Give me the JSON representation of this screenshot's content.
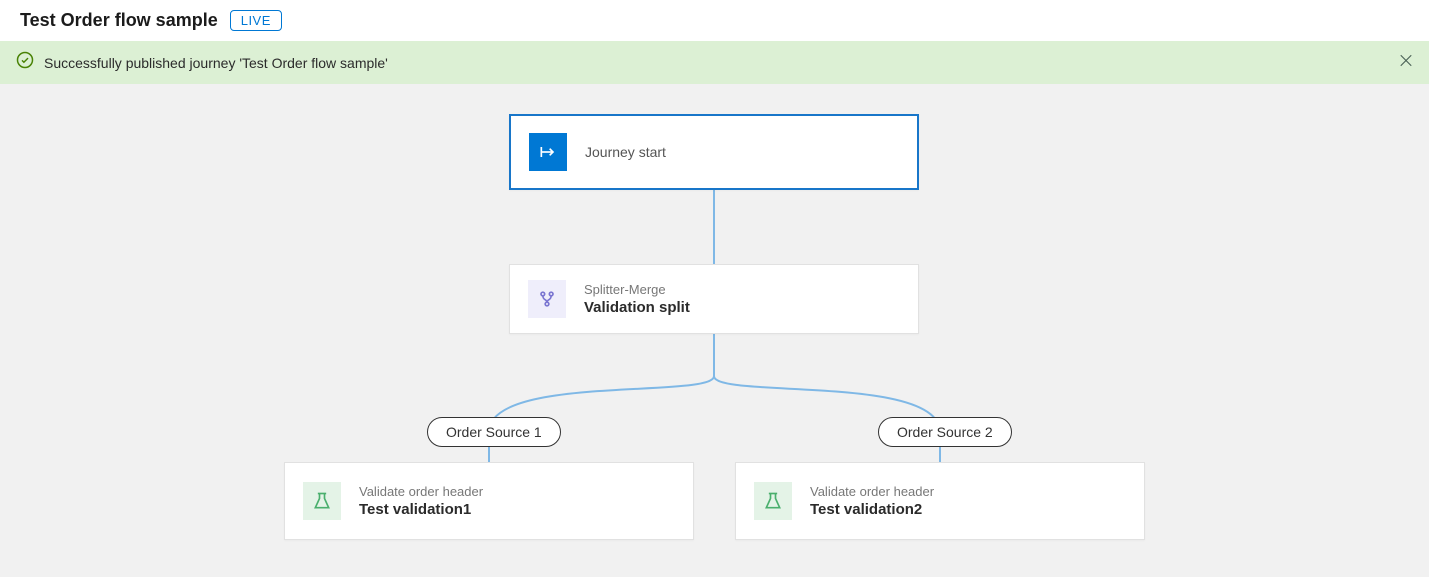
{
  "header": {
    "title": "Test Order flow sample",
    "status_badge": "LIVE"
  },
  "notification": {
    "message": "Successfully published journey 'Test Order flow sample'"
  },
  "nodes": {
    "start": {
      "label": "Journey start"
    },
    "split": {
      "type": "Splitter-Merge",
      "name": "Validation split"
    },
    "branch1": {
      "label": "Order Source 1"
    },
    "branch2": {
      "label": "Order Source 2"
    },
    "leaf1": {
      "type": "Validate order header",
      "name": "Test validation1"
    },
    "leaf2": {
      "type": "Validate order header",
      "name": "Test validation2"
    }
  }
}
